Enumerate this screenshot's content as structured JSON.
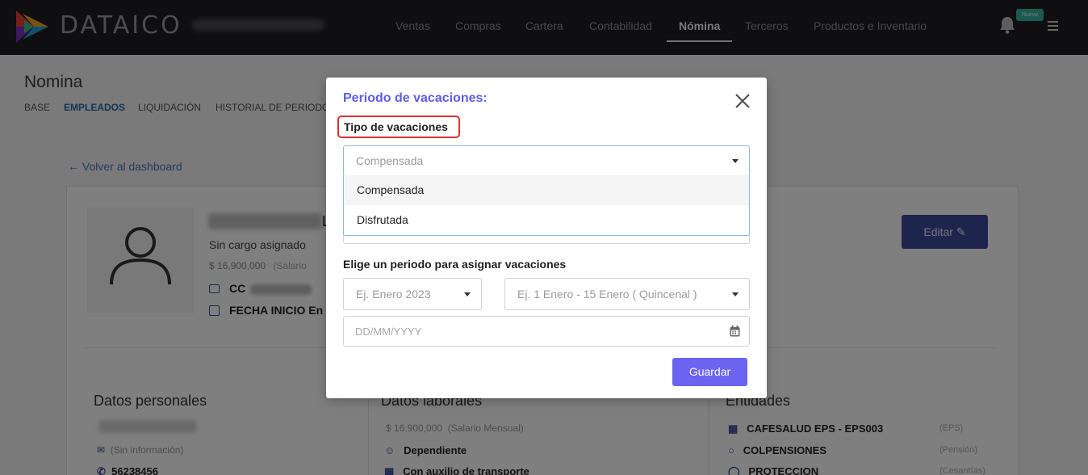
{
  "brand": {
    "name": "DATAICO"
  },
  "nav": {
    "items": [
      {
        "label": "Ventas"
      },
      {
        "label": "Compras"
      },
      {
        "label": "Cartera"
      },
      {
        "label": "Contabilidad"
      },
      {
        "label": "Nómina"
      },
      {
        "label": "Terceros"
      },
      {
        "label": "Productos e Inventario"
      }
    ],
    "active": "Nómina",
    "badge": "Nuevo"
  },
  "page": {
    "title": "Nomina",
    "tabs": [
      {
        "label": "BASE"
      },
      {
        "label": "EMPLEADOS"
      },
      {
        "label": "LIQUIDACIÓN"
      },
      {
        "label": "HISTORIAL DE PERIODOS"
      }
    ],
    "back_link": "← Volver al dashboard"
  },
  "employee": {
    "name_tail": "L",
    "position": "Sin cargo asignado",
    "salary": "$  16,900,000",
    "salary_note": "(Salario",
    "id_label": "CC",
    "start_label": "FECHA INICIO  En",
    "edit_button": "Editar"
  },
  "sections": {
    "personal": {
      "title": "Datos personales",
      "email_note": "(Sin información)",
      "phone": "56238456"
    },
    "laboral": {
      "title": "Datos laborales",
      "salary": "$  16,900,000",
      "salary_note": "(Salario Mensual)",
      "type": "Dependiente",
      "transport": "Con auxilio de transporte"
    },
    "entidades": {
      "title": "Entidades",
      "items": [
        {
          "name": "CAFESALUD EPS - EPS003",
          "kind": "(EPS)"
        },
        {
          "name": "COLPENSIONES",
          "kind": "(Pensión)"
        },
        {
          "name": "PROTECCION",
          "kind": "(Cesantías)"
        }
      ]
    }
  },
  "modal": {
    "title": "Periodo de vacaciones:",
    "tipo_label": "Tipo de vacaciones",
    "tipo_value": "Compensada",
    "options": [
      {
        "label": "Compensada"
      },
      {
        "label": "Disfrutada"
      }
    ],
    "periodo_label": "Elige un periodo para asignar vacaciones",
    "mes_placeholder": "Ej. Enero 2023",
    "quincena_placeholder": "Ej. 1 Enero - 15 Enero ( Quincenal )",
    "date_placeholder": "DD/MM/YYYY",
    "save_button": "Guardar"
  },
  "colors": {
    "accent": "#6c63f0",
    "title": "#5c5ee8",
    "highlight_border": "#e03030",
    "badge": "#35b7a2"
  }
}
